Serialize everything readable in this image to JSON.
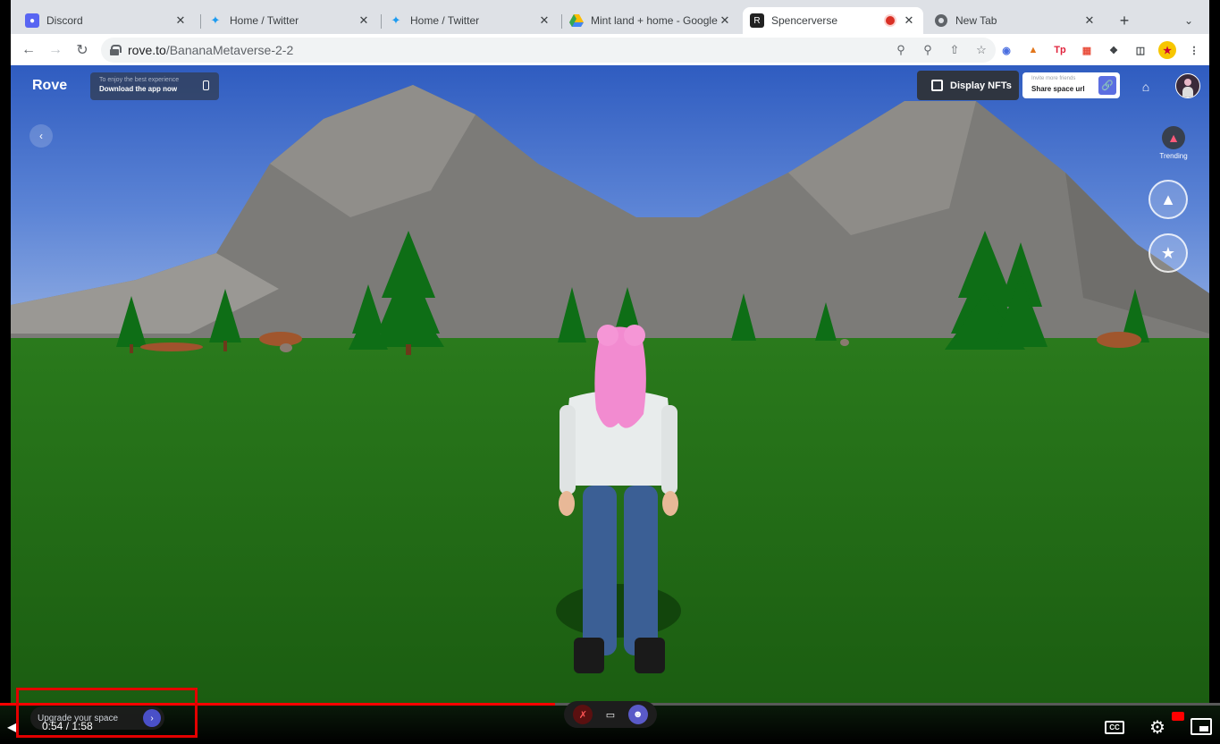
{
  "browser": {
    "tabs": [
      {
        "title": "Discord",
        "favicon": "discord-icon",
        "active": false
      },
      {
        "title": "Home / Twitter",
        "favicon": "twitter-icon",
        "active": false
      },
      {
        "title": "Home / Twitter",
        "favicon": "twitter-icon",
        "active": false
      },
      {
        "title": "Mint land + home - Google",
        "favicon": "google-drive-icon",
        "active": false
      },
      {
        "title": "Spencerverse",
        "favicon": "rove-icon",
        "active": true,
        "recording": true
      },
      {
        "title": "New Tab",
        "favicon": "chrome-icon",
        "active": false
      }
    ],
    "url_host": "rove.to",
    "url_path": "/BananaMetaverse-2-2"
  },
  "rove": {
    "logo": "Rove",
    "download_small": "To enjoy the best experience",
    "download_big": "Download the app now",
    "display_nfts": "Display NFTs",
    "share_small": "Invite more friends",
    "share_big": "Share space url",
    "trending": "Trending",
    "upgrade": "Upgrade your space"
  },
  "player": {
    "time": "0:54 / 1:58",
    "progress": 0.455,
    "cc": "CC"
  },
  "colors": {
    "sky": "#3b66c4",
    "grass": "#1e6b14",
    "progress": "#ff0000",
    "highlight": "#e30000"
  }
}
